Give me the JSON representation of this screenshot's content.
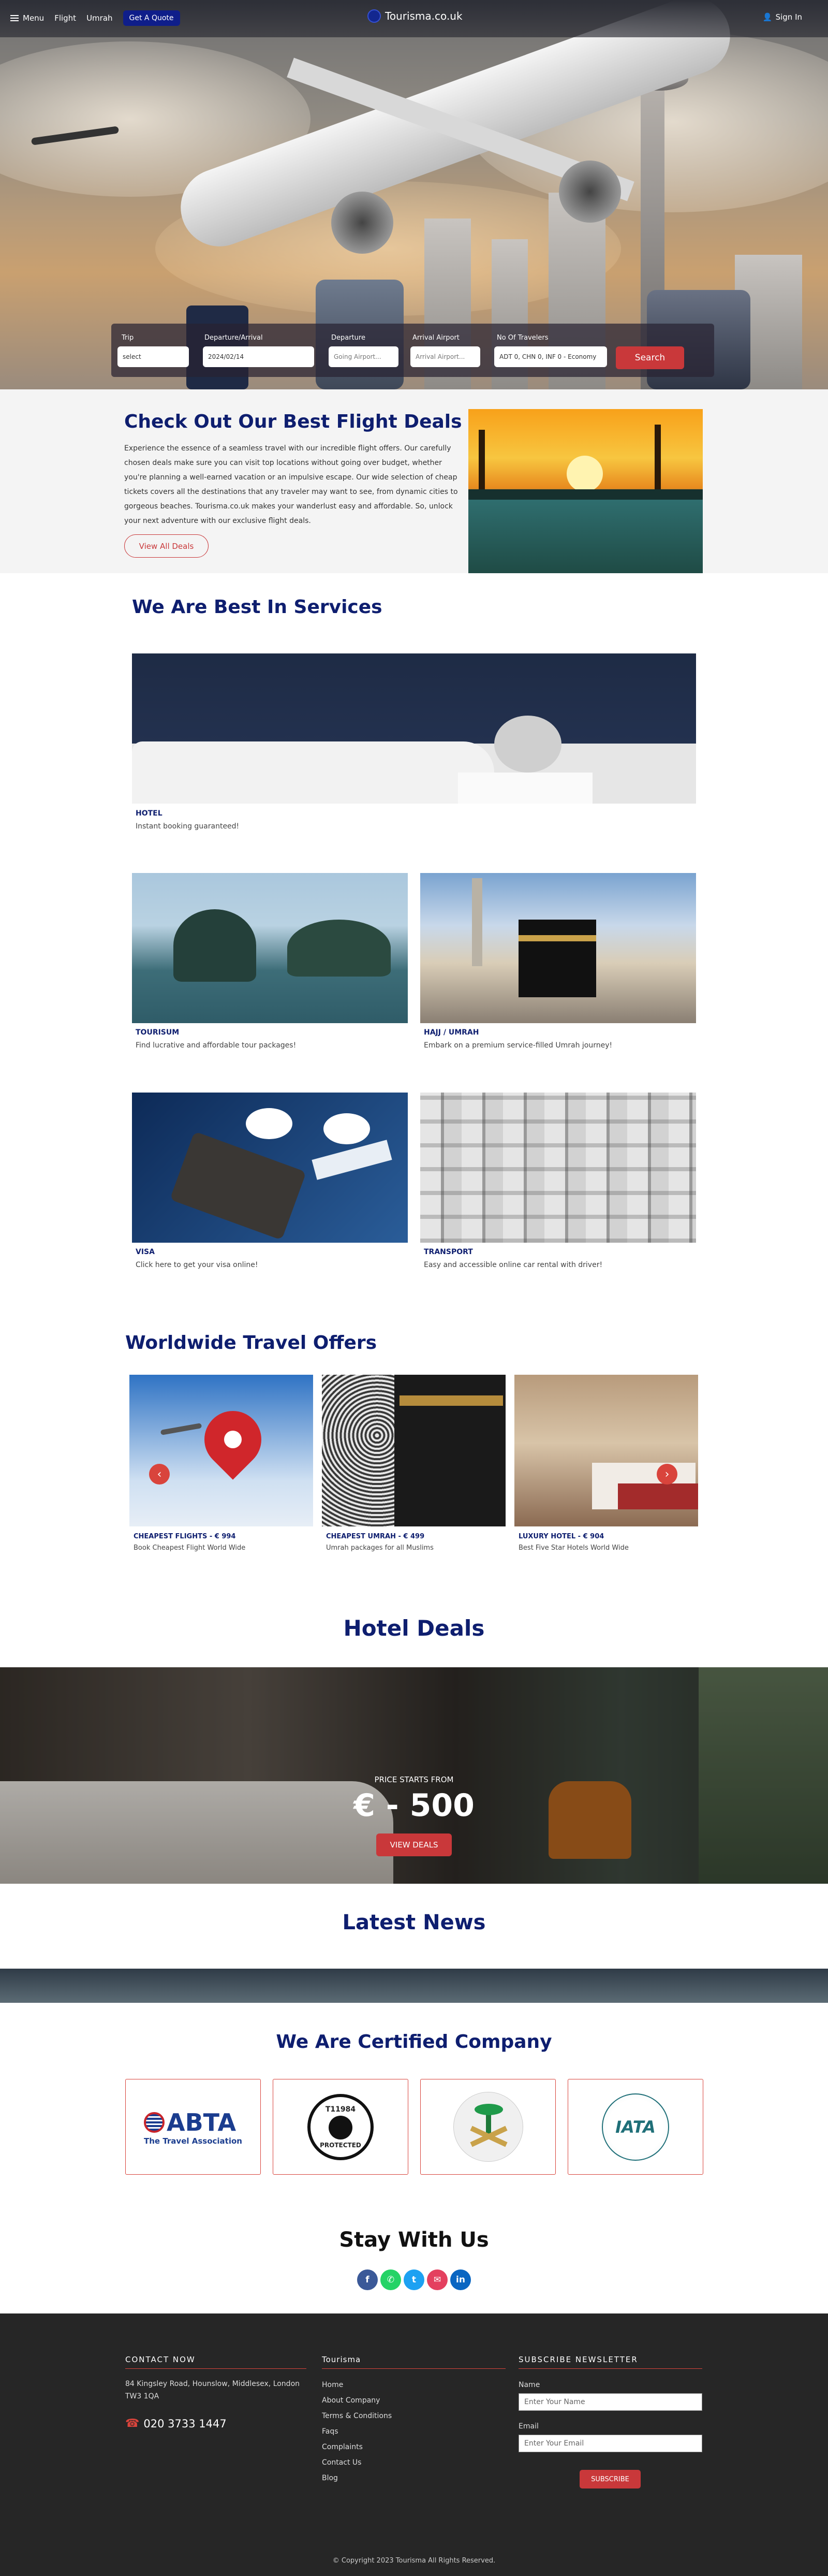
{
  "header": {
    "menu_label": "Menu",
    "nav": [
      "Flight",
      "Umrah"
    ],
    "quote_label": "Get A Quote",
    "logo_text": "Tourisma.co.uk",
    "signin_label": "Sign In"
  },
  "search": {
    "trip_label": "Trip",
    "trip_value": "select",
    "dates_label": "Departure/Arrival",
    "dates_value": "2024/02/14",
    "departure_label": "Departure",
    "departure_placeholder": "Going Airport...",
    "arrival_label": "Arrival Airport",
    "arrival_placeholder": "Arrival Airport...",
    "travelers_label": "No Of Travelers",
    "travelers_value": "ADT 0, CHN 0, INF 0 - Economy",
    "search_label": "Search"
  },
  "deals": {
    "title": "Check Out Our Best Flight Deals",
    "text": "Experience the essence of a seamless travel with our incredible flight offers. Our carefully chosen deals make sure you can visit top locations without going over budget, whether you're planning a well-earned vacation or an impulsive escape. Our wide selection of cheap tickets covers all the destinations that any traveler may want to see, from dynamic cities to gorgeous beaches. Tourisma.co.uk makes your wanderlust easy and affordable. So, unlock your next adventure with our exclusive flight deals.",
    "button": "View All Deals"
  },
  "services": {
    "title": "We Are Best In Services",
    "items": [
      {
        "title": "HOTEL",
        "subtitle": "Instant booking guaranteed!"
      },
      {
        "title": "TOURISUM",
        "subtitle": "Find lucrative and affordable tour packages!"
      },
      {
        "title": "HAJJ / UMRAH",
        "subtitle": "Embark on a premium service-filled Umrah journey!"
      },
      {
        "title": "VISA",
        "subtitle": "Click here to get your visa online!"
      },
      {
        "title": "TRANSPORT",
        "subtitle": "Easy and accessible online car rental with driver!"
      }
    ]
  },
  "offers": {
    "title": "Worldwide Travel Offers",
    "items": [
      {
        "title": "CHEAPEST FLIGHTS - € 994",
        "subtitle": "Book Cheapest Flight World Wide"
      },
      {
        "title": "CHEAPEST UMRAH - € 499",
        "subtitle": "Umrah packages for all Muslims"
      },
      {
        "title": "LUXURY HOTEL - € 904",
        "subtitle": "Best Five Star Hotels World Wide"
      }
    ],
    "prev_icon": "‹",
    "next_icon": "›"
  },
  "hotel_deals": {
    "title": "Hotel Deals",
    "price_caption": "PRICE STARTS FROM",
    "price": "€ - 500",
    "button": "VIEW DEALS"
  },
  "news": {
    "title": "Latest News"
  },
  "certified": {
    "title": "We Are Certified Company",
    "logos": [
      {
        "name": "ABTA",
        "text": "ABTA",
        "sub": "The Travel Association"
      },
      {
        "name": "ATOL",
        "text": "T11984",
        "sub": "PROTECTED"
      },
      {
        "name": "Saudi emblem",
        "text": "",
        "sub": ""
      },
      {
        "name": "IATA",
        "text": "IATA",
        "sub": ""
      }
    ]
  },
  "stay": {
    "title": "Stay With Us",
    "socials": [
      {
        "name": "facebook",
        "glyph": "f",
        "color": "#3b5998"
      },
      {
        "name": "whatsapp",
        "glyph": "✆",
        "color": "#25d366"
      },
      {
        "name": "twitter",
        "glyph": "t",
        "color": "#1da1f2"
      },
      {
        "name": "email",
        "glyph": "✉",
        "color": "#e4405f"
      },
      {
        "name": "linkedin",
        "glyph": "in",
        "color": "#0a66c2"
      }
    ]
  },
  "footer": {
    "contact_title": "CONTACT NOW",
    "address": "84 Kingsley Road, Hounslow, Middlesex, London TW3 1QA",
    "phone": "020 3733 1447",
    "links_title": "Tourisma",
    "links": [
      "Home",
      "About Company",
      "Terms & Conditions",
      "Faqs",
      "Complaints",
      "Contact Us",
      "Blog"
    ],
    "newsletter_title": "SUBSCRIBE NEWSLETTER",
    "name_label": "Name",
    "name_placeholder": "Enter Your Name",
    "email_label": "Email",
    "email_placeholder": "Enter Your Email",
    "subscribe_label": "SUBSCRIBE",
    "copyright": "© Copyright 2023 Tourisma All Rights Reserved."
  },
  "colors": {
    "brand_blue": "#0e1e6f",
    "accent_red": "#c9383a",
    "footer_bg": "#262626"
  }
}
